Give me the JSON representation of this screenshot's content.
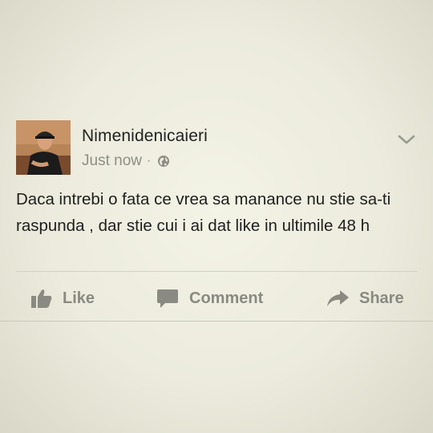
{
  "post": {
    "author": "Nimenidenicaieri",
    "timestamp": "Just now",
    "separator": "·",
    "privacy_icon": "globe-icon",
    "menu_icon": "chevron-down-icon",
    "text": "Daca intrebi o fata ce vrea sa manance nu stie sa-ti raspunda , dar stie cui i ai dat like in ultimile 48 h"
  },
  "actions": {
    "like_label": "Like",
    "comment_label": "Comment",
    "share_label": "Share",
    "like_icon": "thumbs-up-icon",
    "comment_icon": "speech-bubble-icon",
    "share_icon": "share-arrow-icon"
  },
  "colors": {
    "background": "#ecebdd",
    "action_gray": "#8a8a82",
    "meta_gray": "#8e8e86",
    "text": "#202020"
  }
}
